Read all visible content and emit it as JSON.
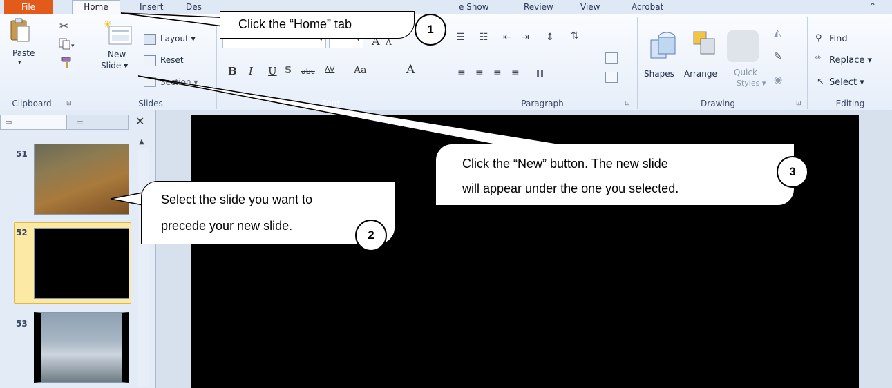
{
  "tabs": {
    "file": "File",
    "home": "Home",
    "insert": "Insert",
    "design": "Des",
    "slideshow": "e Show",
    "review": "Review",
    "view": "View",
    "acrobat": "Acrobat"
  },
  "clipboard": {
    "paste": "Paste",
    "group": "Clipboard"
  },
  "slides": {
    "layout": "Layout ▾",
    "reset": "Reset",
    "new_line1": "New",
    "new_line2": "Slide ▾",
    "section": "Section ▾",
    "group": "Slides"
  },
  "font": {
    "bold": "B",
    "italic": "I",
    "underline": "U",
    "shadow": "S",
    "strike": "abc",
    "spacing": "AV",
    "case": "Aa",
    "color": "A",
    "grow": "A",
    "shrink": "A",
    "group": "Font"
  },
  "paragraph": {
    "group": "Paragraph"
  },
  "drawing": {
    "shapes": "Shapes",
    "arrange": "Arrange",
    "quick_styles_1": "Quick",
    "quick_styles_2": "Styles ▾",
    "group": "Drawing"
  },
  "editing": {
    "find": "Find",
    "replace": "Replace ▾",
    "select": "Select ▾",
    "group": "Editing"
  },
  "slide_list": [
    {
      "num": "51"
    },
    {
      "num": "52"
    },
    {
      "num": "53"
    }
  ],
  "annotations": {
    "step1_text": "Click the “Home” tab",
    "step1_num": "1",
    "step2_line1": "Select the slide you want to",
    "step2_line2": "precede your new slide.",
    "step2_num": "2",
    "step3_line1": "Click the “New” button. The new slide",
    "step3_line2": "will appear under the one you selected.",
    "step3_num": "3"
  }
}
